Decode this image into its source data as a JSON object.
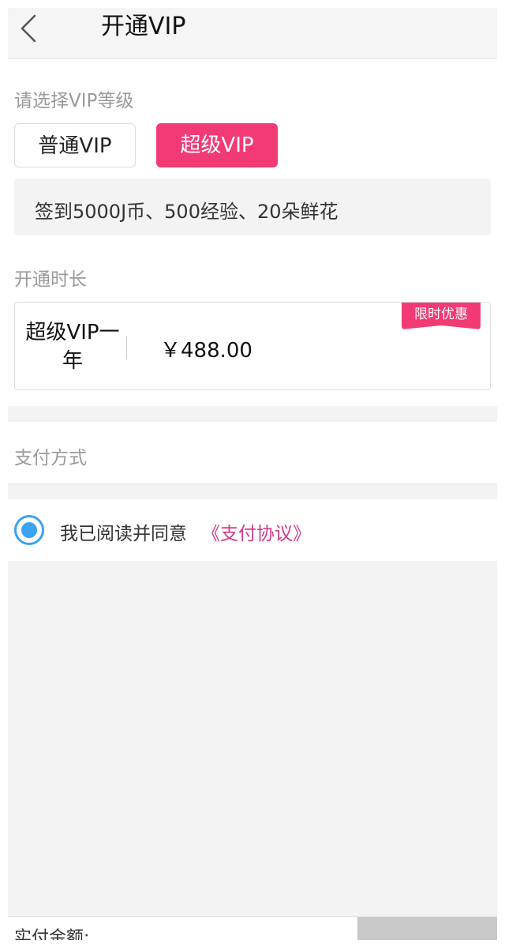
{
  "header": {
    "back_icon": "chevron-left-icon",
    "title": "开通VIP"
  },
  "level_section": {
    "label": "请选择VIP等级",
    "options": [
      {
        "label": "普通VIP",
        "selected": false
      },
      {
        "label": "超级VIP",
        "selected": true
      }
    ],
    "benefit": "签到5000J币、500经验、20朵鲜花"
  },
  "duration_section": {
    "label": "开通时长",
    "plan": {
      "name": "超级VIP一年",
      "price": "￥488.00",
      "tag": "限时优惠"
    }
  },
  "payment_section": {
    "label": "支付方式"
  },
  "agreement": {
    "checked": true,
    "text": "我已阅读并同意",
    "link": "《支付协议》"
  },
  "bottom_bar": {
    "amount_label": "实付金额:"
  },
  "colors": {
    "accent": "#f23a74",
    "link": "#d23a8a",
    "radio": "#3aa2f0"
  }
}
